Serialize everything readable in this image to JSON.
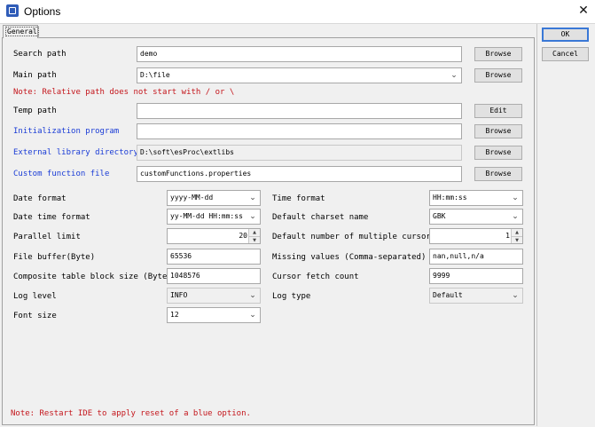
{
  "window": {
    "title": "Options",
    "close_glyph": "✕"
  },
  "tabs": [
    {
      "label": "General"
    }
  ],
  "buttons": {
    "ok": "OK",
    "cancel": "Cancel"
  },
  "paths": [
    {
      "label": "Search path",
      "value": "demo",
      "button": "Browse",
      "color": "black",
      "kind": "text"
    },
    {
      "label": "Main path",
      "value": "D:\\file",
      "button": "Browse",
      "color": "black",
      "kind": "combo"
    },
    {
      "label": "Temp path",
      "value": "",
      "button": "Edit",
      "color": "black",
      "kind": "text"
    },
    {
      "label": "Initialization program",
      "value": "",
      "button": "Browse",
      "color": "blue",
      "kind": "text"
    },
    {
      "label": "External library directory",
      "value": "D:\\soft\\esProc\\extlibs",
      "button": "Browse",
      "color": "blue",
      "kind": "disabled"
    },
    {
      "label": "Custom function file",
      "value": "customFunctions.properties",
      "button": "Browse",
      "color": "blue",
      "kind": "text"
    }
  ],
  "note_relative": "Note: Relative path does not start with / or \\",
  "settings_left": [
    {
      "label": "Date format",
      "value": "yyyy-MM-dd",
      "kind": "combo"
    },
    {
      "label": "Date time format",
      "value": "yy-MM-dd HH:mm:ss",
      "kind": "combo"
    },
    {
      "label": "Parallel limit",
      "value": "20",
      "kind": "spinner"
    },
    {
      "label": "File buffer(Byte)",
      "value": "65536",
      "kind": "text"
    },
    {
      "label": "Composite table block size (Byte)",
      "value": "1048576",
      "kind": "text"
    },
    {
      "label": "Log level",
      "value": "INFO",
      "kind": "combo-disabled"
    },
    {
      "label": "Font size",
      "value": "12",
      "kind": "combo"
    }
  ],
  "settings_right": [
    {
      "label": "Time format",
      "value": "HH:mm:ss",
      "kind": "combo"
    },
    {
      "label": "Default charset name",
      "value": "GBK",
      "kind": "combo"
    },
    {
      "label": "Default number of multiple cursors",
      "value": "1",
      "kind": "spinner"
    },
    {
      "label": "Missing values (Comma-separated)",
      "value": "nan,null,n/a",
      "kind": "text"
    },
    {
      "label": "Cursor fetch count",
      "value": "9999",
      "kind": "text"
    },
    {
      "label": "Log type",
      "value": "Default",
      "kind": "combo-disabled"
    }
  ],
  "note_restart": "Note: Restart IDE to apply reset of a blue option.",
  "colors": {
    "blue_label": "#1a3cd6",
    "note_red": "#c4161c",
    "accent": "#3a78d6"
  },
  "icons": {
    "app": "app-icon",
    "close": "close-icon",
    "dropdown": "chevron-down-icon"
  }
}
